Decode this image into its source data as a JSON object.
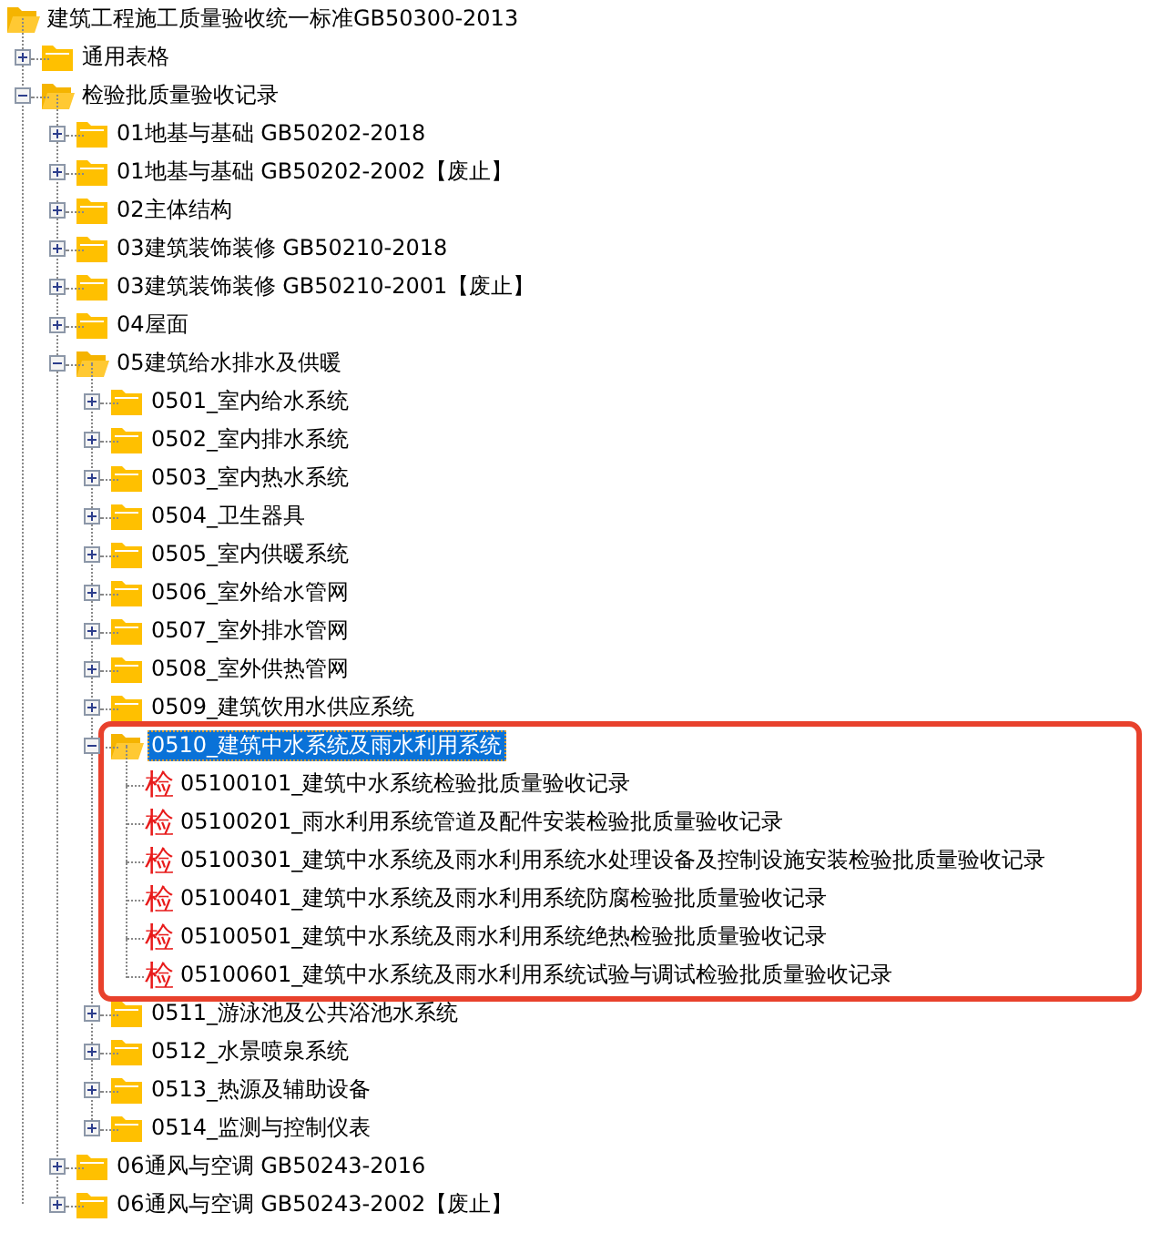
{
  "tree": {
    "kind": "folder",
    "label": "建筑工程施工质量验收统一标准GB50300-2013",
    "expanded": true,
    "selected": false,
    "children": [
      {
        "kind": "folder",
        "label": "通用表格",
        "expanded": false,
        "selected": false
      },
      {
        "kind": "folder",
        "label": "检验批质量验收记录",
        "expanded": true,
        "selected": false,
        "children": [
          {
            "kind": "folder",
            "label": "01地基与基础 GB50202-2018",
            "expanded": false,
            "selected": false
          },
          {
            "kind": "folder",
            "label": "01地基与基础 GB50202-2002【废止】",
            "expanded": false,
            "selected": false
          },
          {
            "kind": "folder",
            "label": "02主体结构",
            "expanded": false,
            "selected": false
          },
          {
            "kind": "folder",
            "label": "03建筑装饰装修 GB50210-2018",
            "expanded": false,
            "selected": false
          },
          {
            "kind": "folder",
            "label": "03建筑装饰装修 GB50210-2001【废止】",
            "expanded": false,
            "selected": false
          },
          {
            "kind": "folder",
            "label": "04屋面",
            "expanded": false,
            "selected": false
          },
          {
            "kind": "folder",
            "label": "05建筑给水排水及供暖",
            "expanded": true,
            "selected": false,
            "children": [
              {
                "kind": "folder",
                "label": "0501_室内给水系统",
                "expanded": false,
                "selected": false
              },
              {
                "kind": "folder",
                "label": "0502_室内排水系统",
                "expanded": false,
                "selected": false
              },
              {
                "kind": "folder",
                "label": "0503_室内热水系统",
                "expanded": false,
                "selected": false
              },
              {
                "kind": "folder",
                "label": "0504_卫生器具",
                "expanded": false,
                "selected": false
              },
              {
                "kind": "folder",
                "label": "0505_室内供暖系统",
                "expanded": false,
                "selected": false
              },
              {
                "kind": "folder",
                "label": "0506_室外给水管网",
                "expanded": false,
                "selected": false
              },
              {
                "kind": "folder",
                "label": "0507_室外排水管网",
                "expanded": false,
                "selected": false
              },
              {
                "kind": "folder",
                "label": "0508_室外供热管网",
                "expanded": false,
                "selected": false
              },
              {
                "kind": "folder",
                "label": "0509_建筑饮用水供应系统",
                "expanded": false,
                "selected": false
              },
              {
                "kind": "folder",
                "label": "0510_建筑中水系统及雨水利用系统",
                "expanded": true,
                "selected": true,
                "children": [
                  {
                    "kind": "record",
                    "icon_text": "检",
                    "label": "05100101_建筑中水系统检验批质量验收记录",
                    "selected": false
                  },
                  {
                    "kind": "record",
                    "icon_text": "检",
                    "label": "05100201_雨水利用系统管道及配件安装检验批质量验收记录",
                    "selected": false
                  },
                  {
                    "kind": "record",
                    "icon_text": "检",
                    "label": "05100301_建筑中水系统及雨水利用系统水处理设备及控制设施安装检验批质量验收记录",
                    "selected": false
                  },
                  {
                    "kind": "record",
                    "icon_text": "检",
                    "label": "05100401_建筑中水系统及雨水利用系统防腐检验批质量验收记录",
                    "selected": false
                  },
                  {
                    "kind": "record",
                    "icon_text": "检",
                    "label": "05100501_建筑中水系统及雨水利用系统绝热检验批质量验收记录",
                    "selected": false
                  },
                  {
                    "kind": "record",
                    "icon_text": "检",
                    "label": "05100601_建筑中水系统及雨水利用系统试验与调试检验批质量验收记录",
                    "selected": false
                  }
                ]
              },
              {
                "kind": "folder",
                "label": "0511_游泳池及公共浴池水系统",
                "expanded": false,
                "selected": false
              },
              {
                "kind": "folder",
                "label": "0512_水景喷泉系统",
                "expanded": false,
                "selected": false
              },
              {
                "kind": "folder",
                "label": "0513_热源及辅助设备",
                "expanded": false,
                "selected": false
              },
              {
                "kind": "folder",
                "label": "0514_监测与控制仪表",
                "expanded": false,
                "selected": false
              }
            ]
          },
          {
            "kind": "folder",
            "label": "06通风与空调 GB50243-2016",
            "expanded": false,
            "selected": false
          },
          {
            "kind": "folder",
            "label": "06通风与空调 GB50243-2002【废止】",
            "expanded": false,
            "selected": false
          }
        ]
      }
    ]
  }
}
